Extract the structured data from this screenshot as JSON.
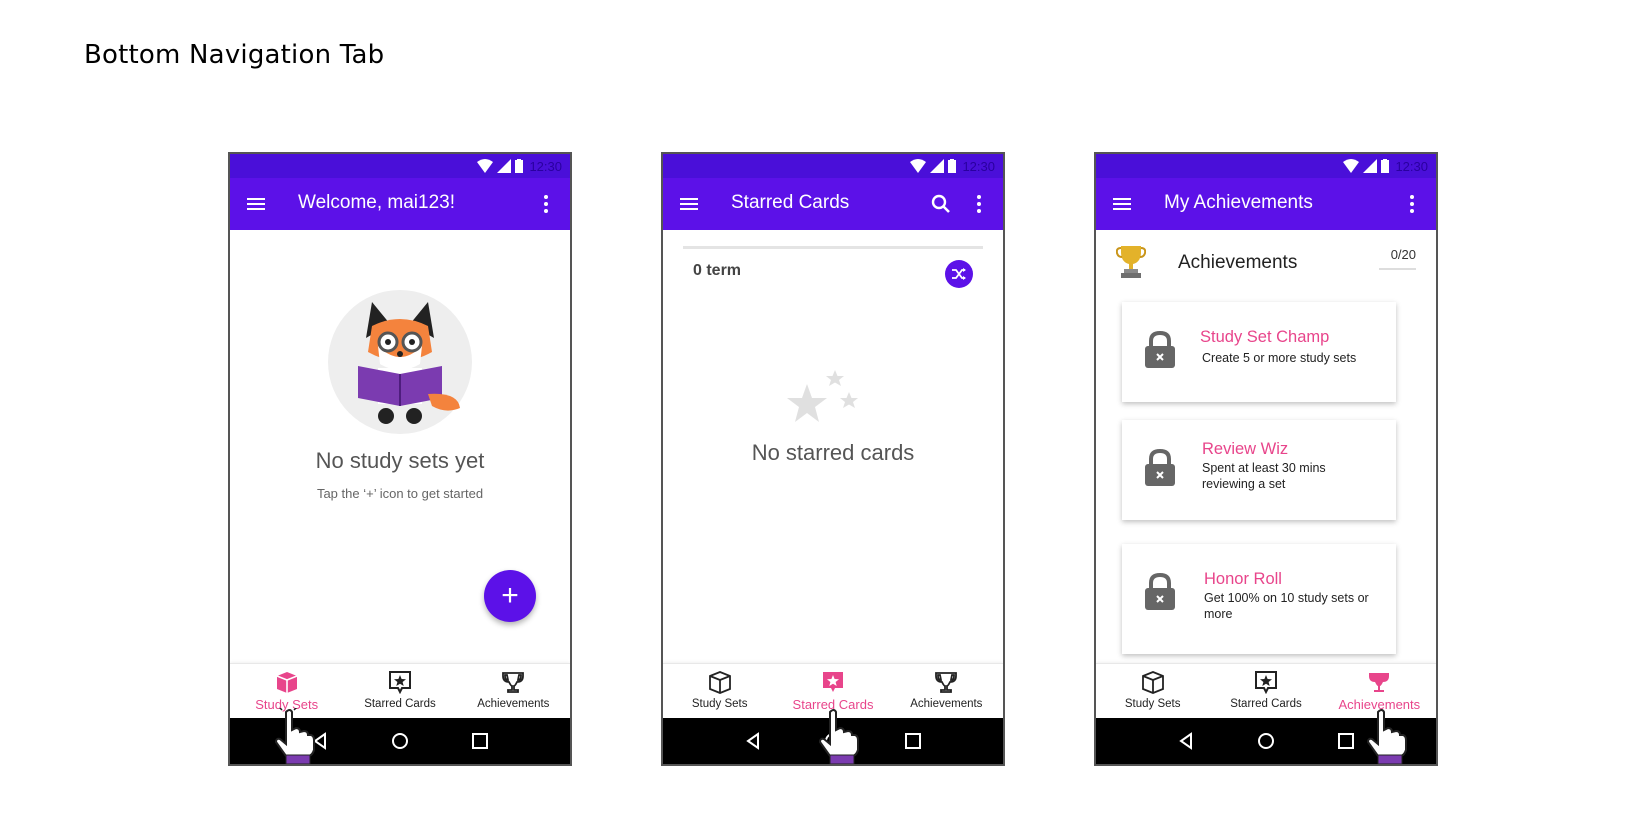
{
  "page": {
    "title": "Bottom  Navigation Tab"
  },
  "status": {
    "time": "12:30"
  },
  "screens": {
    "study_sets": {
      "appbar_title": "Welcome, mai123!",
      "empty_title": "No study sets yet",
      "empty_subtitle": "Tap the ‘+’ icon to get started",
      "fab_label": "+"
    },
    "starred": {
      "appbar_title": "Starred Cards",
      "term_count": "0 term",
      "empty_title": "No starred cards"
    },
    "achievements": {
      "appbar_title": "My Achievements",
      "section_title": "Achievements",
      "count": "0/20",
      "cards": [
        {
          "title": "Study Set Champ",
          "desc": "Create 5 or more study sets"
        },
        {
          "title": "Review Wiz",
          "desc": "Spent at least 30 mins reviewing a set"
        },
        {
          "title": "Honor Roll",
          "desc": "Get 100% on 10 study sets or more"
        }
      ]
    }
  },
  "nav": {
    "study_sets": "Study Sets",
    "starred_cards": "Starred Cards",
    "achievements": "Achievements"
  },
  "colors": {
    "primary": "#5c11e8",
    "statusbar": "#4a0fd9",
    "accent": "#e8458b"
  }
}
